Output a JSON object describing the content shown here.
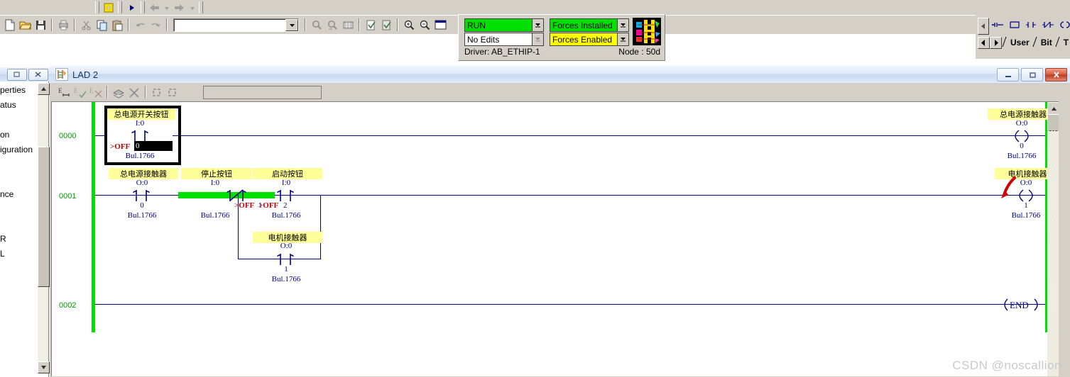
{
  "app": {
    "watermark": "CSDN @noscallion"
  },
  "toolbar_top": {
    "icons": [
      "new-file-icon",
      "open-folder-icon",
      "save-disk-icon",
      "print-icon",
      "cut-scissors-icon",
      "copy-icon",
      "paste-icon",
      "undo-icon",
      "redo-icon",
      "find-icon",
      "find-replace-icon",
      "cross-reference-icon",
      "verify-file-icon",
      "verify-project-icon",
      "zoom-in-icon",
      "zoom-out-icon",
      "view-window-icon"
    ],
    "online_icons": [
      "insert-rung-icon",
      "run-arrow-icon",
      "back-arrow-icon",
      "back-dropdown-icon",
      "forward-arrow-icon",
      "forward-dropdown-icon"
    ],
    "address_combo": {
      "value": "",
      "placeholder": ""
    }
  },
  "status_panel": {
    "mode": "RUN",
    "edits": "No Edits",
    "forces_installed": "Forces Installed",
    "forces_enabled": "Forces Enabled",
    "driver": "Driver: AB_ETHIP-1",
    "node": "Node : 50d",
    "colors": {
      "run_bg": "#00e000",
      "forces_installed_bg": "#00e000",
      "forces_enabled_bg": "#ffff00",
      "edits_bg": "#ffffff"
    }
  },
  "instruction_palette": {
    "symbols": [
      "branch-icon",
      "rung-icon",
      "xic-contact-icon",
      "xio-contact-icon",
      "ote-coil-icon"
    ],
    "tabs": [
      "User",
      "Bit",
      "T"
    ],
    "nav": [
      "tab-prev-icon",
      "tab-next-icon",
      "palette-scroll-left-icon"
    ]
  },
  "project_tree": {
    "window_buttons": [
      "restore-button",
      "close-button"
    ],
    "items": [
      {
        "label": "perties"
      },
      {
        "label": "atus"
      },
      {
        "label": ""
      },
      {
        "label": "on"
      },
      {
        "label": "iguration"
      },
      {
        "label": ""
      },
      {
        "label": ""
      },
      {
        "label": "nce"
      },
      {
        "label": ""
      },
      {
        "label": ""
      },
      {
        "label": "R"
      },
      {
        "label": "L"
      }
    ]
  },
  "lad_window": {
    "title": "LAD 2",
    "window_buttons": {
      "minimize": "–",
      "restore": "□",
      "close": "×"
    },
    "toolbar_icons": [
      "edit-rung-icon",
      "edit-accept-icon",
      "edit-cancel-icon",
      "stack-icon",
      "delete-x-icon",
      "refresh-1-icon",
      "refresh-2-icon"
    ],
    "edit_field": ""
  },
  "ladder": {
    "rails": {
      "color": "#00e000"
    },
    "rung_numbers": [
      "0000",
      "0001",
      "0002"
    ],
    "end_label": "END",
    "bul_text": "Bul.1766",
    "rungs": [
      {
        "number": "0000",
        "selected": true,
        "elements": [
          {
            "kind": "xic-contact",
            "label": "总电源开关按钮",
            "address": "I:0",
            "bit": "0",
            "state": "&gt;OFF",
            "state_text": ">OFF",
            "module": "Bul.1766",
            "energized": false,
            "selected": true
          }
        ],
        "output": {
          "kind": "ote-coil",
          "label": "总电源接触器",
          "address": "O:0",
          "bit": "0",
          "module": "Bul.1766"
        }
      },
      {
        "number": "0001",
        "selected": false,
        "elements": [
          {
            "kind": "xic-contact",
            "label": "总电源接触器",
            "address": "O:0",
            "bit": "0",
            "state_text": "",
            "module": "Bul.1766",
            "energized": false
          },
          {
            "kind": "xio-contact",
            "label": "停止按钮",
            "address": "I:0",
            "bit": "1",
            "state_text": ">OFF",
            "module": "Bul.1766",
            "energized": true
          },
          {
            "kind": "xic-contact",
            "label": "启动按钮",
            "address": "I:0",
            "bit": "2",
            "state_text": ">OFF",
            "module": "Bul.1766",
            "energized": false,
            "branch": "top"
          },
          {
            "kind": "xic-contact",
            "label": "电机接触器",
            "address": "O:0",
            "bit": "1",
            "state_text": "",
            "module": "Bul.1766",
            "energized": false,
            "branch": "bottom"
          }
        ],
        "output": {
          "kind": "ote-coil",
          "label": "电机接触器",
          "address": "O:0",
          "bit": "1",
          "module": "Bul.1766",
          "annotation": "red-arrow"
        }
      },
      {
        "number": "0002",
        "selected": false,
        "elements": [],
        "output": {
          "kind": "end",
          "label": "END"
        }
      }
    ]
  }
}
